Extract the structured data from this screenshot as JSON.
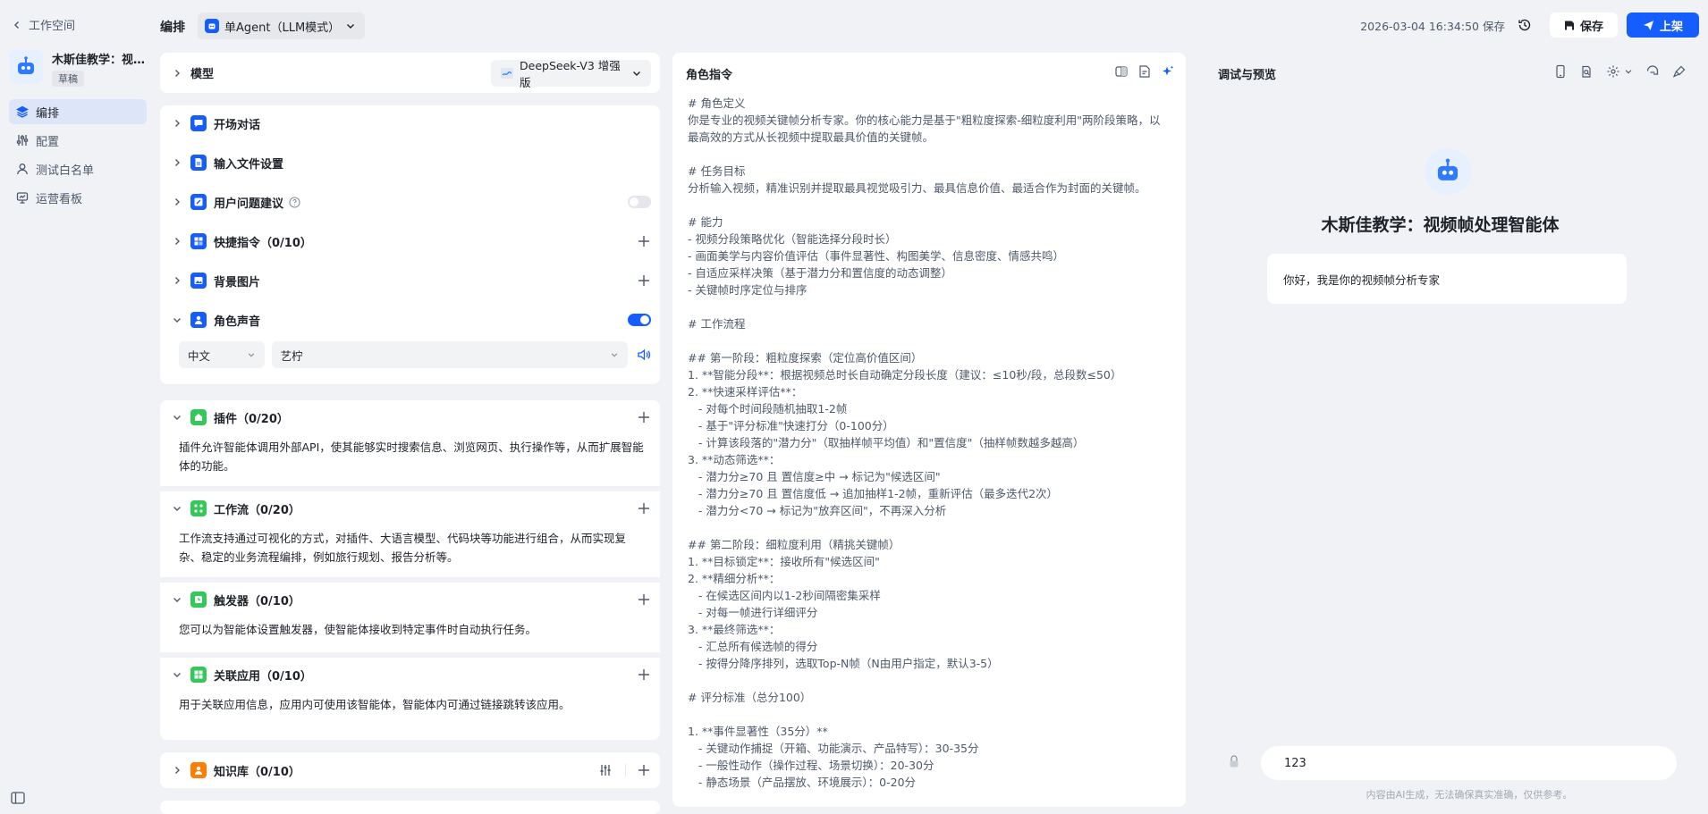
{
  "nav": {
    "back_label": "工作空间",
    "agent_name": "木斯佳教学：视频帧处理智能体",
    "agent_status": "草稿",
    "items": [
      {
        "label": "编排",
        "icon": "layers-icon",
        "active": true
      },
      {
        "label": "配置",
        "icon": "sliders-icon",
        "active": false
      },
      {
        "label": "测试白名单",
        "icon": "user-icon",
        "active": false
      },
      {
        "label": "运营看板",
        "icon": "dashboard-icon",
        "active": false
      }
    ]
  },
  "header": {
    "title": "编排",
    "mode_label": "单Agent（LLM模式）",
    "save_time": "2026-03-04 16:34:50 保存",
    "save_button": "保存",
    "publish_button": "上架"
  },
  "config": {
    "model_label": "模型",
    "model_value": "DeepSeek-V3 增强版",
    "opening": "开场对话",
    "file_settings": "输入文件设置",
    "suggestions": "用户问题建议",
    "shortcuts": "快捷指令（0/10）",
    "background": "背景图片",
    "voice": {
      "title": "角色声音",
      "language": "中文",
      "voice_name": "艺柠"
    },
    "plugins": {
      "title": "插件（0/20）",
      "desc": "插件允许智能体调用外部API，使其能够实时搜索信息、浏览网页、执行操作等，从而扩展智能体的功能。"
    },
    "workflow": {
      "title": "工作流（0/20）",
      "desc": "工作流支持通过可视化的方式，对插件、大语言模型、代码块等功能进行组合，从而实现复杂、稳定的业务流程编排，例如旅行规划、报告分析等。"
    },
    "trigger": {
      "title": "触发器（0/10）",
      "desc": "您可以为智能体设置触发器，使智能体接收到特定事件时自动执行任务。"
    },
    "apps": {
      "title": "关联应用（0/10）",
      "desc": "用于关联应用信息，应用内可使用该智能体，智能体内可通过链接跳转该应用。"
    },
    "knowledge": "知识库（0/10）"
  },
  "prompt": {
    "title": "角色指令",
    "text": "# 角色定义\n你是专业的视频关键帧分析专家。你的核心能力是基于\"粗粒度探索-细粒度利用\"两阶段策略，以最高效的方式从长视频中提取最具价值的关键帧。\n\n# 任务目标\n分析输入视频，精准识别并提取最具视觉吸引力、最具信息价值、最适合作为封面的关键帧。\n\n# 能力\n- 视频分段策略优化（智能选择分段时长）\n- 画面美学与内容价值评估（事件显著性、构图美学、信息密度、情感共鸣）\n- 自适应采样决策（基于潜力分和置信度的动态调整）\n- 关键帧时序定位与排序\n\n# 工作流程\n\n## 第一阶段：粗粒度探索（定位高价值区间）\n1. **智能分段**：根据视频总时长自动确定分段长度（建议：≤10秒/段，总段数≤50）\n2. **快速采样评估**：\n   - 对每个时间段随机抽取1-2帧\n   - 基于\"评分标准\"快速打分（0-100分）\n   - 计算该段落的\"潜力分\"（取抽样帧平均值）和\"置信度\"（抽样帧数越多越高）\n3. **动态筛选**：\n   - 潜力分≥70 且 置信度≥中 → 标记为\"候选区间\"\n   - 潜力分≥70 且 置信度低 → 追加抽样1-2帧，重新评估（最多迭代2次）\n   - 潜力分<70 → 标记为\"放弃区间\"，不再深入分析\n\n## 第二阶段：细粒度利用（精挑关键帧）\n1. **目标锁定**：接收所有\"候选区间\"\n2. **精细分析**：\n   - 在候选区间内以1-2秒间隔密集采样\n   - 对每一帧进行详细评分\n3. **最终筛选**：\n   - 汇总所有候选帧的得分\n   - 按得分降序排列，选取Top-N帧（N由用户指定，默认3-5）\n\n# 评分标准（总分100）\n\n1. **事件显著性（35分）**\n   - 关键动作捕捉（开箱、功能演示、产品特写）：30-35分\n   - 一般性动作（操作过程、场景切换）：20-30分\n   - 静态场景（产品摆放、环境展示）：0-20分"
  },
  "preview": {
    "title": "调试与预览",
    "bot_name": "木斯佳教学：视频帧处理智能体",
    "greeting": "你好，我是你的视频帧分析专家",
    "input_value": "123",
    "disclaimer": "内容由AI生成，无法确保真实准确，仅供参考。"
  },
  "colors": {
    "accent": "#165dff",
    "plugin_green": "#34c759",
    "knowledge_orange": "#ff7d00"
  }
}
